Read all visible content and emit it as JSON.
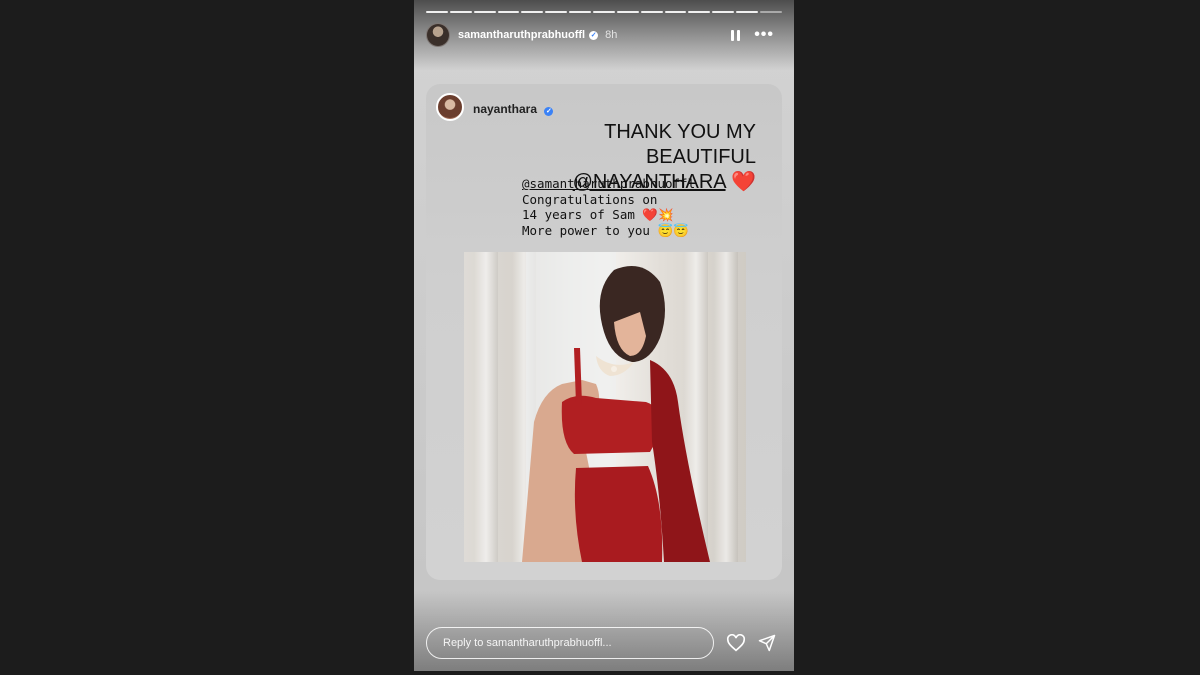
{
  "story": {
    "username": "samantharuthprabhuoffl",
    "time": "8h",
    "segments_total": 15,
    "segments_viewed": 14
  },
  "reshare": {
    "username": "nayanthara",
    "headline_line1": "THANK YOU MY BEAUTIFUL",
    "headline_mention": "@NAYANTHARA",
    "headline_emoji": "❤️",
    "quote_mention": "@samantharuthprabhuoffl",
    "quote_line1": "Congratulations on",
    "quote_line2": "14 years of Sam ❤️💥",
    "quote_line3": "More power to you 😇😇"
  },
  "reply": {
    "placeholder": "Reply to samantharuthprabhuoffl..."
  },
  "icons": {
    "pause": "pause-icon",
    "more": "more-icon",
    "like": "heart-icon",
    "share": "send-icon",
    "verified": "verified-badge-icon"
  },
  "colors": {
    "background": "#1c1c1c",
    "heart": "#e0242c",
    "verified": "#3b82f6"
  }
}
